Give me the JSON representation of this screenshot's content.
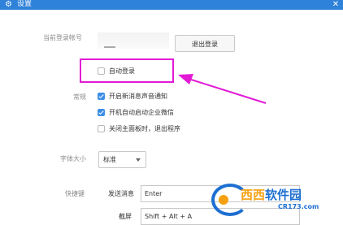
{
  "window": {
    "title": "设置",
    "close_glyph": "✕",
    "title_icon": "gear-icon",
    "title_icon_glyph": "⚙"
  },
  "account": {
    "label": "当前登录帐号",
    "logout_button": "退出登录"
  },
  "auto_login": {
    "label": "自动登录",
    "checked": false
  },
  "general": {
    "label": "常规",
    "options": [
      {
        "label": "开启新消息声音通知",
        "checked": true
      },
      {
        "label": "开机自动启动企业微信",
        "checked": true
      },
      {
        "label": "关闭主面板时，退出程序",
        "checked": false
      }
    ]
  },
  "font_size": {
    "label": "字体大小",
    "selected": "标准"
  },
  "shortcuts": {
    "label": "快捷键",
    "send_label": "发送消息",
    "send_value": "Enter",
    "screenshot_label": "截屏",
    "screenshot_value": "Shift + Alt + A"
  },
  "annotation": {
    "highlight_color": "#e21ad6",
    "arrow_color": "#e21ad6"
  },
  "watermark": {
    "text_part1": "西西",
    "text_part2": "软件园",
    "url": "CR173.com",
    "primary_color": "#1d6fd1",
    "accent_color": "#f5a012"
  },
  "colors": {
    "titlebar": "#2f82d9",
    "checkbox_checked": "#3c8ee6"
  }
}
